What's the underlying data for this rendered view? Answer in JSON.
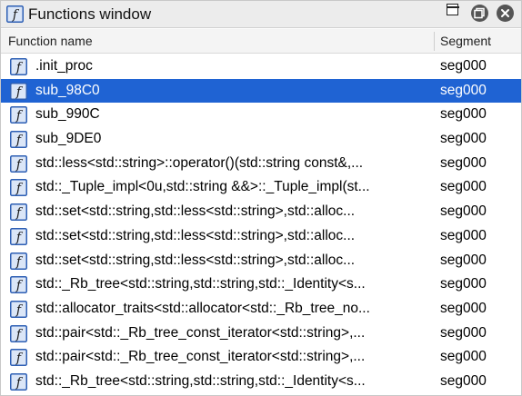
{
  "window": {
    "title": "Functions window",
    "icon": "function-f-icon",
    "buttons": [
      "pin-icon",
      "restore-icon",
      "close-icon"
    ]
  },
  "columns": {
    "name": "Function name",
    "segment": "Segment"
  },
  "colors": {
    "selection": "#1f63d3",
    "icon_fill": "#dbe6f7",
    "icon_border": "#2d5fb4"
  },
  "functions": [
    {
      "name": ".init_proc",
      "segment": "seg000",
      "selected": false
    },
    {
      "name": "sub_98C0",
      "segment": "seg000",
      "selected": true
    },
    {
      "name": "sub_990C",
      "segment": "seg000",
      "selected": false
    },
    {
      "name": "sub_9DE0",
      "segment": "seg000",
      "selected": false
    },
    {
      "name": "std::less<std::string>::operator()(std::string const&,...",
      "segment": "seg000",
      "selected": false
    },
    {
      "name": "std::_Tuple_impl<0u,std::string &&>::_Tuple_impl(st...",
      "segment": "seg000",
      "selected": false
    },
    {
      "name": "std::set<std::string,std::less<std::string>,std::alloc...",
      "segment": "seg000",
      "selected": false
    },
    {
      "name": "std::set<std::string,std::less<std::string>,std::alloc...",
      "segment": "seg000",
      "selected": false
    },
    {
      "name": "std::set<std::string,std::less<std::string>,std::alloc...",
      "segment": "seg000",
      "selected": false
    },
    {
      "name": "std::_Rb_tree<std::string,std::string,std::_Identity<s...",
      "segment": "seg000",
      "selected": false
    },
    {
      "name": "std::allocator_traits<std::allocator<std::_Rb_tree_no...",
      "segment": "seg000",
      "selected": false
    },
    {
      "name": "std::pair<std::_Rb_tree_const_iterator<std::string>,...",
      "segment": "seg000",
      "selected": false
    },
    {
      "name": "std::pair<std::_Rb_tree_const_iterator<std::string>,...",
      "segment": "seg000",
      "selected": false
    },
    {
      "name": "std::_Rb_tree<std::string,std::string,std::_Identity<s...",
      "segment": "seg000",
      "selected": false
    }
  ]
}
